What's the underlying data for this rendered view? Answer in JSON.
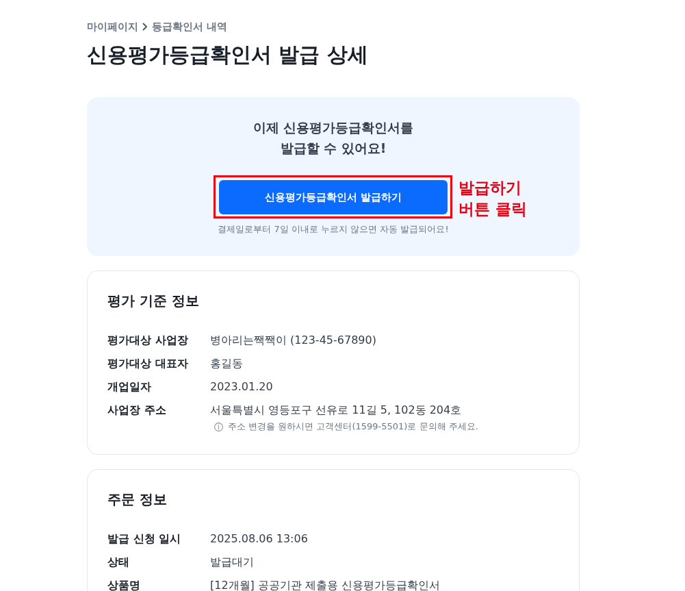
{
  "breadcrumb": [
    {
      "label": "마이페이지"
    },
    {
      "label": "등급확인서 내역"
    }
  ],
  "title": "신용평가등급확인서 발급 상세",
  "issue_banner": {
    "headline": "이제 신용평가등급확인서를\n발급할 수 있어요!",
    "button": "신용평가등급확인서 발급하기",
    "note": "결제일로부터 7일 이내로 누르지 않으면 자동 발급되어요!",
    "annotation": {
      "text": "발급하기\n버튼 클릭"
    }
  },
  "sections": [
    {
      "title": "평가 기준 정보",
      "rows": [
        {
          "label": "평가대상 사업장",
          "value": "병아리는짹짹이 (123-45-67890)"
        },
        {
          "label": "평가대상 대표자",
          "value": "홍길동"
        },
        {
          "label": "개업일자",
          "value": "2023.01.20"
        },
        {
          "label": "사업장 주소",
          "value": "서울특별시 영등포구 선유로 11길 5, 102동 204호",
          "note": "주소 변경을 원하시면 고객센터(1599-5501)로 문의해 주세요."
        }
      ]
    },
    {
      "title": "주문 정보",
      "rows": [
        {
          "label": "발급 신청 일시",
          "value": "2025.08.06 13:06"
        },
        {
          "label": "상태",
          "value": "발급대기"
        },
        {
          "label": "상품명",
          "value": "[12개월] 공공기관 제출용 신용평가등급확인서"
        }
      ]
    }
  ]
}
